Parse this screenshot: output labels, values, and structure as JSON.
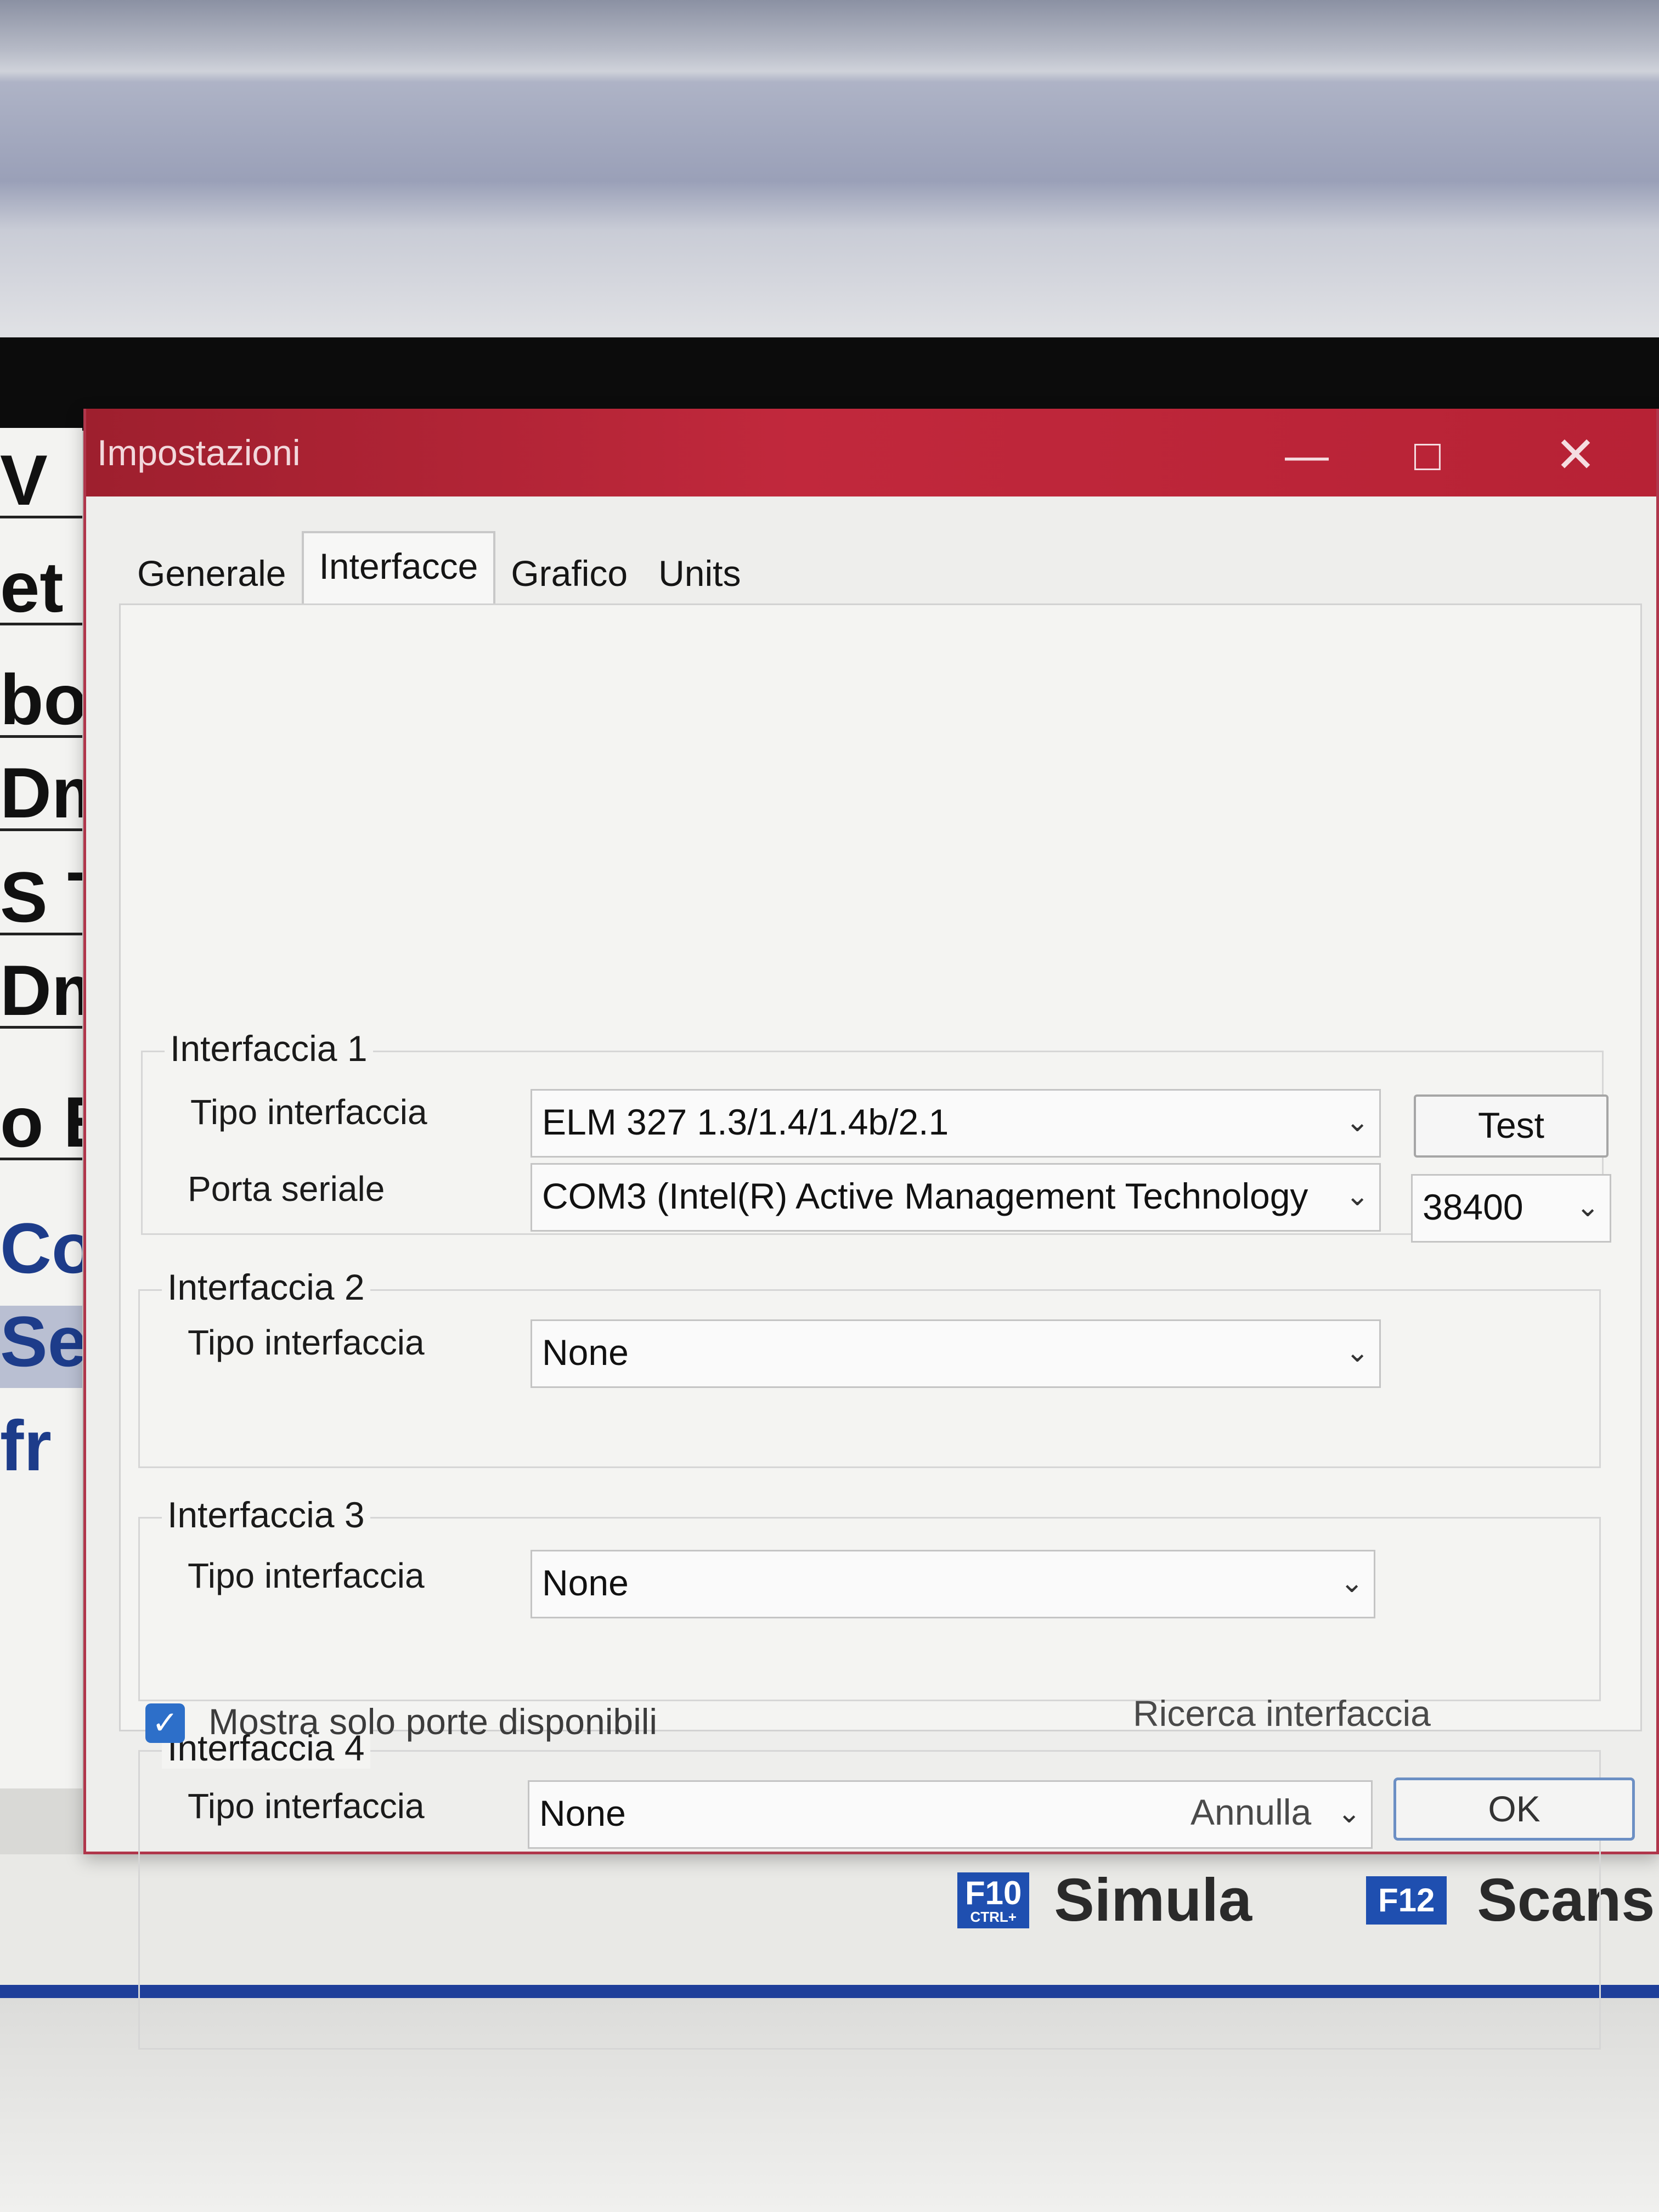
{
  "background": {
    "left_items": [
      "V",
      "et",
      "bo",
      "Dm",
      "S T",
      "Dm",
      "o E",
      "Co",
      "Se",
      "fr"
    ],
    "fkeys": [
      {
        "key": "F10",
        "sub": "CTRL+",
        "label": "Simula"
      },
      {
        "key": "F12",
        "sub": "",
        "label": "Scans"
      }
    ]
  },
  "dialog": {
    "title": "Impostazioni",
    "tabs": [
      {
        "label": "Generale",
        "active": false
      },
      {
        "label": "Interfacce",
        "active": true
      },
      {
        "label": "Grafico",
        "active": false
      },
      {
        "label": "Units",
        "active": false
      }
    ],
    "groups": [
      {
        "title": "Interfaccia 1",
        "type_label": "Tipo interfaccia",
        "type_value": "ELM 327 1.3/1.4/1.4b/2.1",
        "test_label": "Test",
        "port_label": "Porta seriale",
        "port_value": "COM3   (Intel(R) Active Management Technology",
        "baud_value": "38400"
      },
      {
        "title": "Interfaccia 2",
        "type_label": "Tipo interfaccia",
        "type_value": "None"
      },
      {
        "title": "Interfaccia 3",
        "type_label": "Tipo interfaccia",
        "type_value": "None"
      },
      {
        "title": "Interfaccia 4",
        "type_label": "Tipo interfaccia",
        "type_value": "None"
      }
    ],
    "show_available_ports": {
      "label": "Mostra solo porte disponibili",
      "checked": true
    },
    "search_interface_label": "Ricerca interfaccia",
    "cancel_label": "Annulla",
    "ok_label": "OK"
  },
  "colors": {
    "titlebar": "#b72235",
    "checkbox": "#2d6fc9",
    "fkey_badge": "#1f4fb0"
  }
}
